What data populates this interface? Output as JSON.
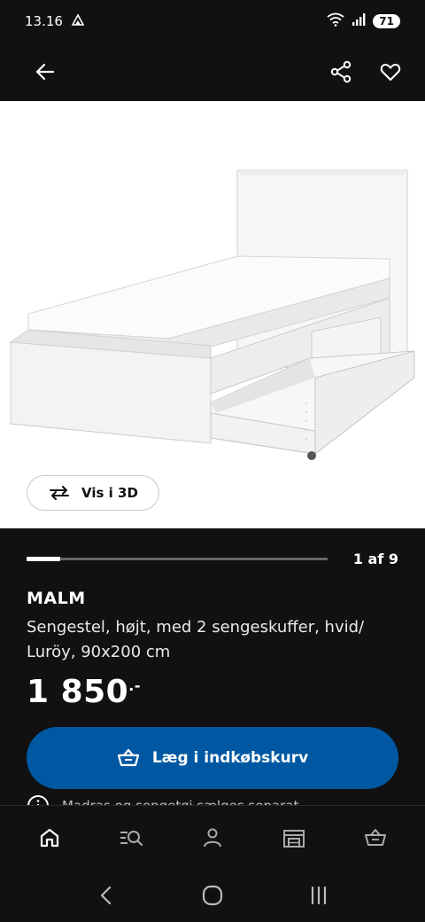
{
  "status": {
    "time": "13.16",
    "battery": "71"
  },
  "gallery": {
    "view_3d_label": "Vis i 3D",
    "counter": "1 af 9",
    "progress": 0.111
  },
  "product": {
    "name": "MALM",
    "description": "Sengestel, højt, med 2 sengeskuffer, hvid/ Luröy, 90x200 cm",
    "price": "1 850",
    "price_suffix": ".-"
  },
  "cta": {
    "add_to_cart_label": "Læg i indkøbskurv"
  },
  "info": {
    "text": "Madras og sengetøj sælges separat"
  },
  "colors": {
    "accent": "#0058a3",
    "background": "#111111"
  },
  "icons": {
    "header": [
      "back-arrow-icon",
      "share-icon",
      "heart-icon"
    ],
    "bottom_nav": [
      "home-icon",
      "search-icon",
      "profile-icon",
      "store-icon",
      "cart-icon"
    ]
  }
}
